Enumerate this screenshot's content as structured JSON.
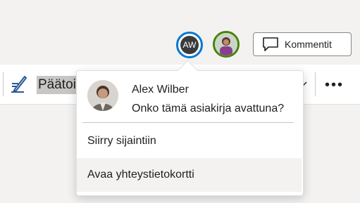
{
  "collaborators": {
    "current_initials": "AW"
  },
  "toolbar": {
    "comments_label": "Kommentit",
    "editor_mode_label": "Päätoimittaja",
    "more_label": "•••"
  },
  "presence_popup": {
    "name": "Alex Wilber",
    "status": "Onko tämä asiakirja avattuna?",
    "menu": [
      {
        "label": "Siirry sijaintiin"
      },
      {
        "label": "Avaa yhteystietokortti"
      }
    ]
  },
  "colors": {
    "accent": "#0078d4",
    "presence_green": "#498205",
    "editor_icon": "#2b5797"
  }
}
